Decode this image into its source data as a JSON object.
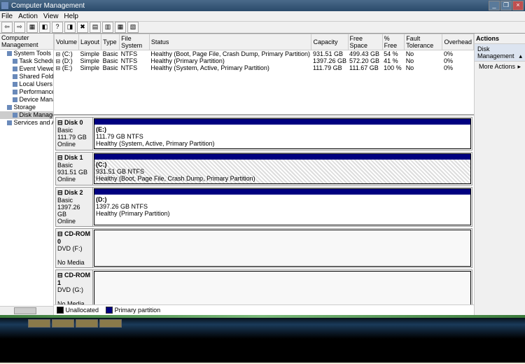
{
  "title": "Computer Management",
  "menu": {
    "file": "File",
    "action": "Action",
    "view": "View",
    "help": "Help"
  },
  "tree": {
    "root": "Computer Management",
    "items": [
      {
        "label": "System Tools",
        "lvl": 1
      },
      {
        "label": "Task Scheduler",
        "lvl": 2
      },
      {
        "label": "Event Viewer",
        "lvl": 2
      },
      {
        "label": "Shared Folders",
        "lvl": 2
      },
      {
        "label": "Local Users and Gro",
        "lvl": 2
      },
      {
        "label": "Performance",
        "lvl": 2
      },
      {
        "label": "Device Manager",
        "lvl": 2
      },
      {
        "label": "Storage",
        "lvl": 1
      },
      {
        "label": "Disk Management",
        "lvl": 2,
        "sel": true
      },
      {
        "label": "Services and Applicati",
        "lvl": 1
      }
    ]
  },
  "grid": {
    "headers": [
      "Volume",
      "Layout",
      "Type",
      "File System",
      "Status",
      "Capacity",
      "Free Space",
      "% Free",
      "Fault Tolerance",
      "Overhead"
    ],
    "rows": [
      [
        "(C:)",
        "Simple",
        "Basic",
        "NTFS",
        "Healthy (Boot, Page File, Crash Dump, Primary Partition)",
        "931.51 GB",
        "499.43 GB",
        "54 %",
        "No",
        "0%"
      ],
      [
        "(D:)",
        "Simple",
        "Basic",
        "NTFS",
        "Healthy (Primary Partition)",
        "1397.26 GB",
        "572.20 GB",
        "41 %",
        "No",
        "0%"
      ],
      [
        "(E:)",
        "Simple",
        "Basic",
        "NTFS",
        "Healthy (System, Active, Primary Partition)",
        "111.79 GB",
        "111.67 GB",
        "100 %",
        "No",
        "0%"
      ]
    ]
  },
  "disks": [
    {
      "name": "Disk 0",
      "type": "Basic",
      "size": "111.79 GB",
      "state": "Online",
      "vol": {
        "label": "(E:)",
        "info": "111.79 GB NTFS",
        "status": "Healthy (System, Active, Primary Partition)",
        "style": "plain"
      }
    },
    {
      "name": "Disk 1",
      "type": "Basic",
      "size": "931.51 GB",
      "state": "Online",
      "vol": {
        "label": "(C:)",
        "info": "931.51 GB NTFS",
        "status": "Healthy (Boot, Page File, Crash Dump, Primary Partition)",
        "style": "hatched"
      }
    },
    {
      "name": "Disk 2",
      "type": "Basic",
      "size": "1397.26 GB",
      "state": "Online",
      "vol": {
        "label": "(D:)",
        "info": "1397.26 GB NTFS",
        "status": "Healthy (Primary Partition)",
        "style": "plain"
      }
    },
    {
      "name": "CD-ROM 0",
      "type": "DVD (F:)",
      "size": "",
      "state": "No Media",
      "vol": null
    },
    {
      "name": "CD-ROM 1",
      "type": "DVD (G:)",
      "size": "",
      "state": "No Media",
      "vol": null
    }
  ],
  "legend": {
    "unalloc": "Unallocated",
    "primary": "Primary partition"
  },
  "actions": {
    "hdr": "Actions",
    "section": "Disk Management",
    "more": "More Actions"
  }
}
